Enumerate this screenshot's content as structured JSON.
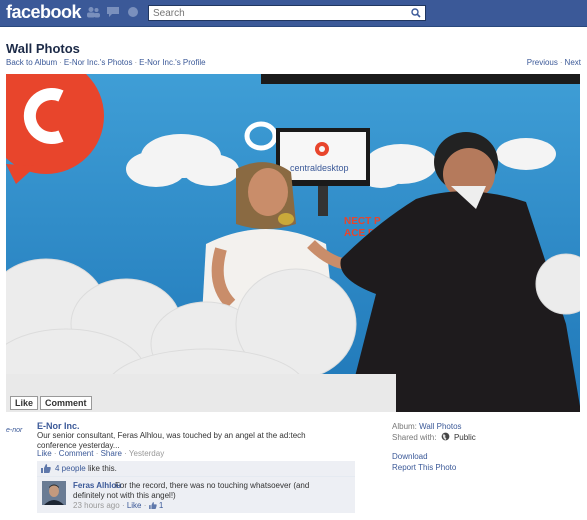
{
  "topbar": {
    "logo": "facebook",
    "search_placeholder": "Search",
    "icons": [
      "friends-icon",
      "messages-icon",
      "notifications-icon",
      "search-icon"
    ]
  },
  "header": {
    "title": "Wall Photos",
    "breadcrumbs": [
      "Back to Album",
      "E-Nor Inc.'s Photos",
      "E-Nor Inc.'s Profile"
    ],
    "previous": "Previous",
    "next": "Next"
  },
  "photo": {
    "actions": [
      "Like",
      "Comment"
    ],
    "screen_text": "centraldesktop",
    "backdrop_text_1": "NECT P",
    "backdrop_text_2": "ACE D"
  },
  "post": {
    "owner_logo": "e-nor",
    "owner": "E-Nor Inc.",
    "caption": "Our senior consultant, Feras Alhlou, was touched by an angel at the ad:tech conference yesterday...",
    "actions": [
      "Like",
      "Comment",
      "Share"
    ],
    "time": "Yesterday",
    "likes": "4 people",
    "likes_suffix": "like this."
  },
  "comment": {
    "author": "Feras Alhlou",
    "text": "For the record, there was no touching whatsoever (and definitely not with this angel!)",
    "time": "23 hours ago",
    "like": "Like",
    "like_count": "1"
  },
  "sidebar": {
    "album_label": "Album:",
    "album": "Wall Photos",
    "shared_label": "Shared with:",
    "shared": "Public",
    "download": "Download",
    "report": "Report This Photo"
  },
  "colors": {
    "brand": "#3b5998",
    "backdrop": "#2e8ecb",
    "logo_red": "#e8452c"
  }
}
